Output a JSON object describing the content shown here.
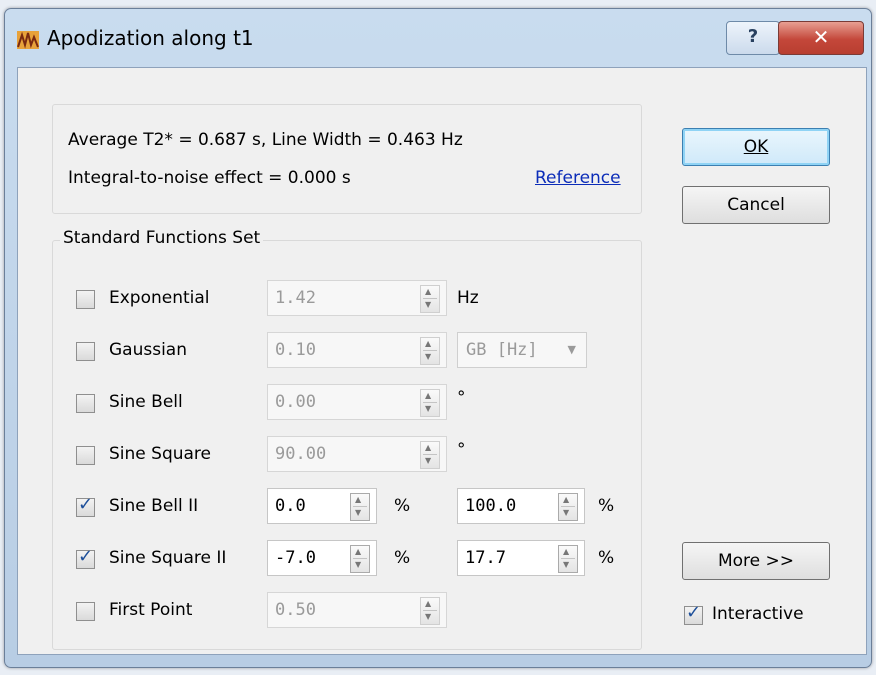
{
  "window": {
    "title": "Apodization along t1",
    "help_label": "?",
    "close_label": "✕"
  },
  "info": {
    "line1": "Average T2* = 0.687 s, Line Width = 0.463 Hz",
    "line2": "Integral-to-noise effect = 0.000 s",
    "reference_link": "Reference"
  },
  "group": {
    "title": "Standard Functions Set",
    "rows": [
      {
        "label": "Exponential",
        "checked": false,
        "value1": "1.42",
        "unit1": "Hz"
      },
      {
        "label": "Gaussian",
        "checked": false,
        "value1": "0.10",
        "select": "GB [Hz]"
      },
      {
        "label": "Sine Bell",
        "checked": false,
        "value1": "0.00",
        "unit1": "°"
      },
      {
        "label": "Sine Square",
        "checked": false,
        "value1": "90.00",
        "unit1": "°"
      },
      {
        "label": "Sine Bell II",
        "checked": true,
        "value1": "0.0",
        "unit1": "%",
        "value2": "100.0",
        "unit2": "%"
      },
      {
        "label": "Sine Square II",
        "checked": true,
        "value1": "-7.0",
        "unit1": "%",
        "value2": "17.7",
        "unit2": "%"
      },
      {
        "label": "First Point",
        "checked": false,
        "value1": "0.50"
      }
    ]
  },
  "buttons": {
    "ok": "OK",
    "cancel": "Cancel",
    "more": "More >>"
  },
  "interactive": {
    "label": "Interactive",
    "checked": true
  }
}
